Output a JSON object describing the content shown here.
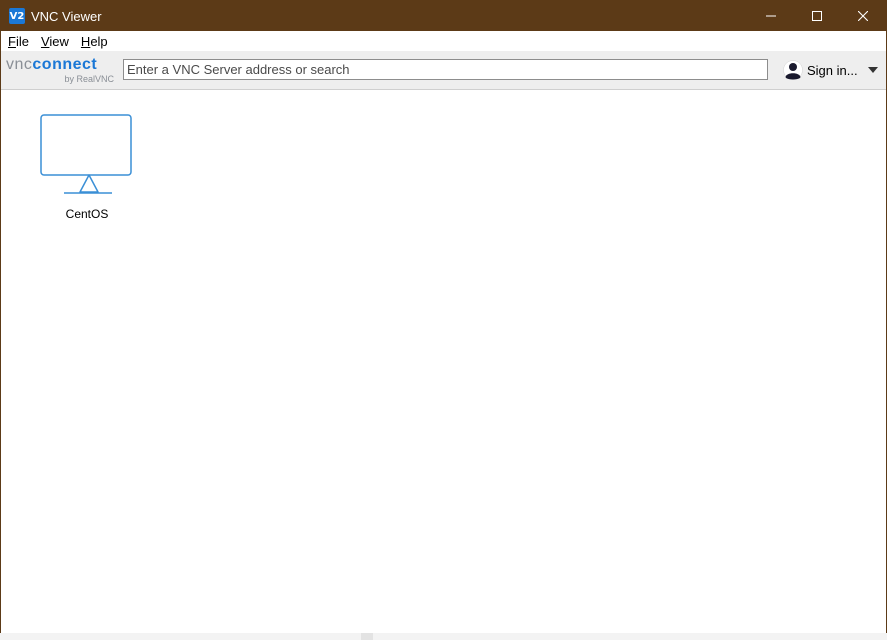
{
  "window": {
    "title": "VNC Viewer",
    "app_icon_text": "V2",
    "titlebar_color": "#5c3a17"
  },
  "menu": {
    "items": [
      {
        "accel": "F",
        "rest": "ile"
      },
      {
        "accel": "V",
        "rest": "iew"
      },
      {
        "accel": "H",
        "rest": "elp"
      }
    ]
  },
  "toolbar": {
    "logo_vnc": "vnc",
    "logo_connect": "connect",
    "logo_sub": "by RealVNC",
    "search_placeholder": "Enter a VNC Server address or search",
    "search_value": "",
    "signin_label": "Sign in...",
    "accent_color": "#1b78d6"
  },
  "address_book": {
    "entries": [
      {
        "label": "CentOS",
        "icon": "monitor-icon"
      }
    ]
  }
}
